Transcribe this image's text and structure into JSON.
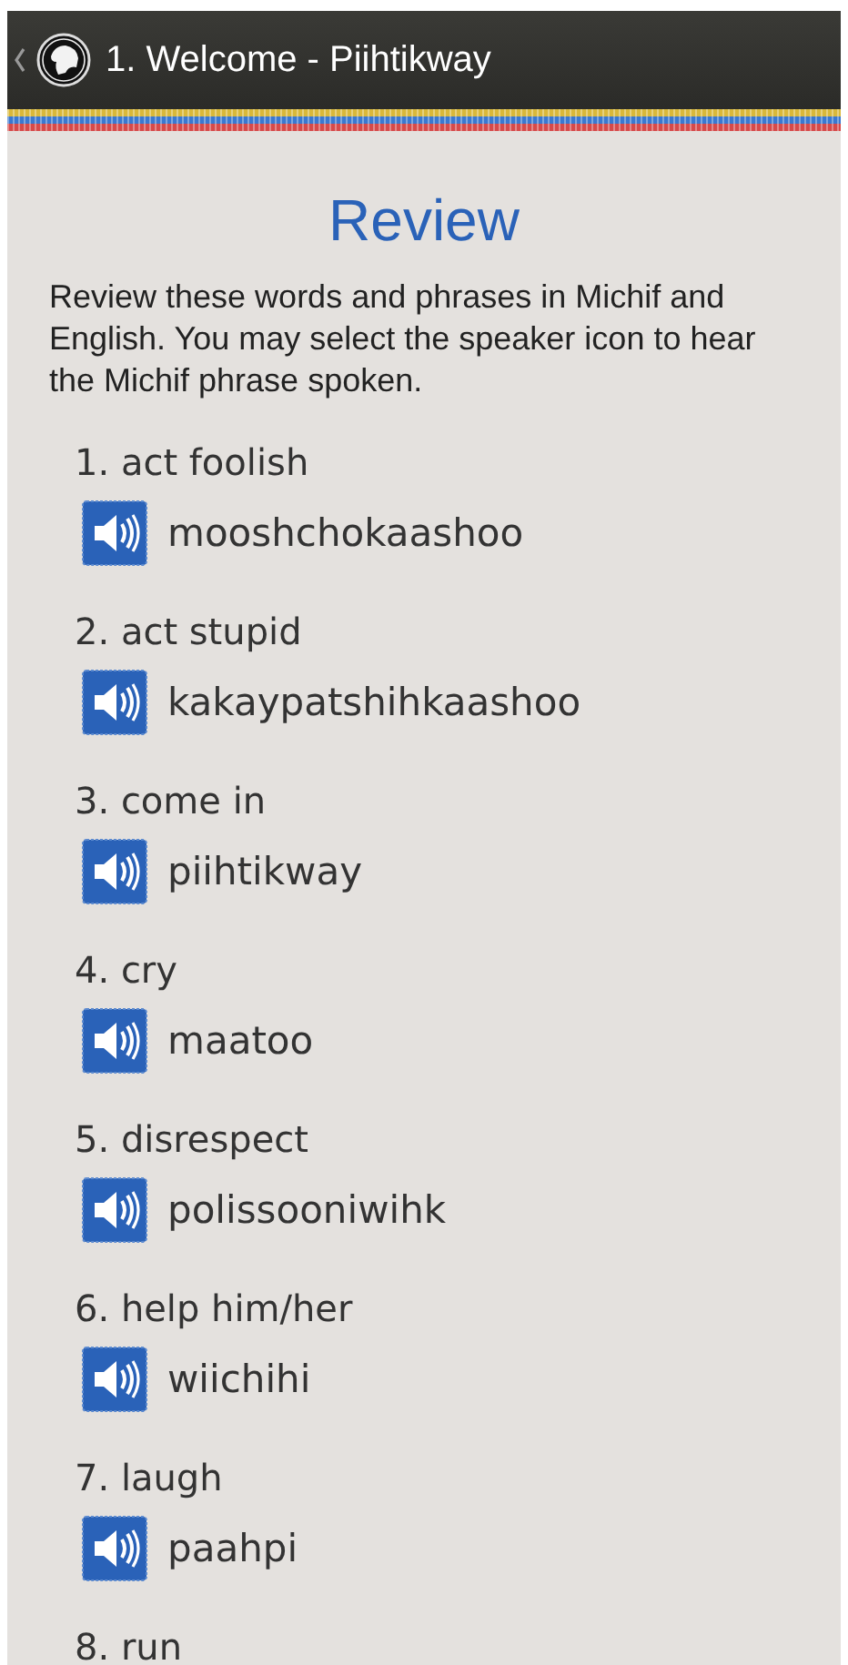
{
  "header": {
    "title": "1. Welcome - Piihtikway"
  },
  "heading": "Review",
  "intro": "Review these words and phrases in Michif and English. You may select the speaker icon to hear the Michif phrase spoken.",
  "entries": [
    {
      "english": "1. act foolish",
      "michif": "mooshchokaashoo"
    },
    {
      "english": "2. act stupid",
      "michif": "kakaypatshihkaashoo"
    },
    {
      "english": "3. come in",
      "michif": "piihtikway"
    },
    {
      "english": "4. cry",
      "michif": "maatoo"
    },
    {
      "english": "5. disrespect",
      "michif": "polissooniwihk"
    },
    {
      "english": "6. help him/her",
      "michif": "wiichihi"
    },
    {
      "english": "7. laugh",
      "michif": "paahpi"
    },
    {
      "english": "8. run"
    }
  ]
}
